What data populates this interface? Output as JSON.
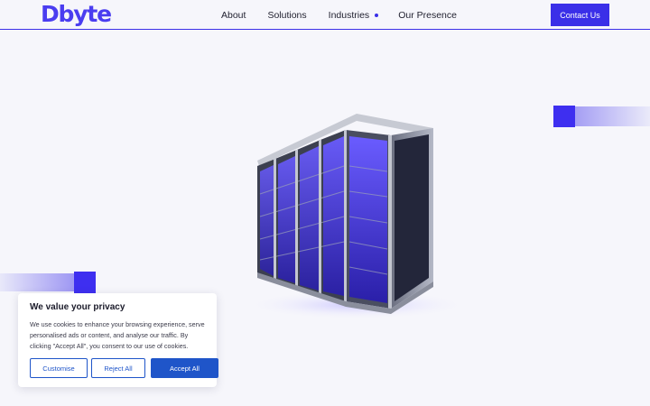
{
  "header": {
    "logo_text": "Dbyte",
    "nav": [
      {
        "label": "About"
      },
      {
        "label": "Solutions"
      },
      {
        "label": "Industries"
      },
      {
        "label": "Our Presence"
      }
    ],
    "contact_label": "Contact Us"
  },
  "cookie_banner": {
    "title": "We value your privacy",
    "text": "We use cookies to enhance your browsing experience, serve personalised ads or content, and analyse our traffic. By clicking \"Accept All\", you consent to our use of cookies.",
    "customise_label": "Customise",
    "reject_label": "Reject All",
    "accept_label": "Accept All"
  },
  "colors": {
    "brand": "#3a2fe8",
    "cookie_button": "#1f55c9",
    "background": "#f6f6fb"
  }
}
